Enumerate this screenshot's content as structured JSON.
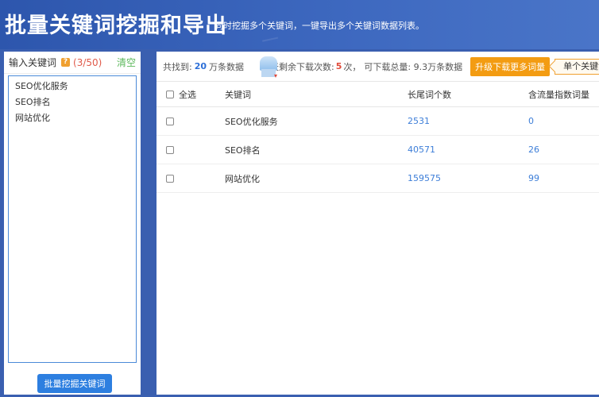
{
  "banner": {
    "title": "批量关键词挖掘和导出",
    "subtitle": "同时挖掘多个关键词，一键导出多个关键词数据列表。"
  },
  "left_panel": {
    "title": "输入关键词",
    "help_icon": "question-icon",
    "count": "(3/50)",
    "clear_label": "清空",
    "keywords": [
      "SEO优化服务",
      "SEO排名",
      "网站优化"
    ],
    "mine_button": "批量挖掘关键词"
  },
  "stats": {
    "found_prefix": "共找到:",
    "found_value": "20",
    "found_suffix": "万条数据",
    "remaining_prefix": "今天剩余下载次数:",
    "remaining_value": "5",
    "remaining_suffix": "次，",
    "total_text": "可下载总量: 9.3万条数据",
    "upgrade_button": "升级下载更多词量",
    "single_tag": "单个关键词"
  },
  "table": {
    "headers": {
      "select_all": "全选",
      "keyword": "关键词",
      "longtail": "长尾词个数",
      "index": "含流量指数词量"
    },
    "rows": [
      {
        "keyword": "SEO优化服务",
        "longtail": "2531",
        "index": "0"
      },
      {
        "keyword": "SEO排名",
        "longtail": "40571",
        "index": "26"
      },
      {
        "keyword": "网站优化",
        "longtail": "159575",
        "index": "99"
      }
    ]
  },
  "colors": {
    "primary": "#2d7fe0",
    "accent": "#f39c12",
    "count": "#e05a4a",
    "clear": "#5cb85c"
  }
}
